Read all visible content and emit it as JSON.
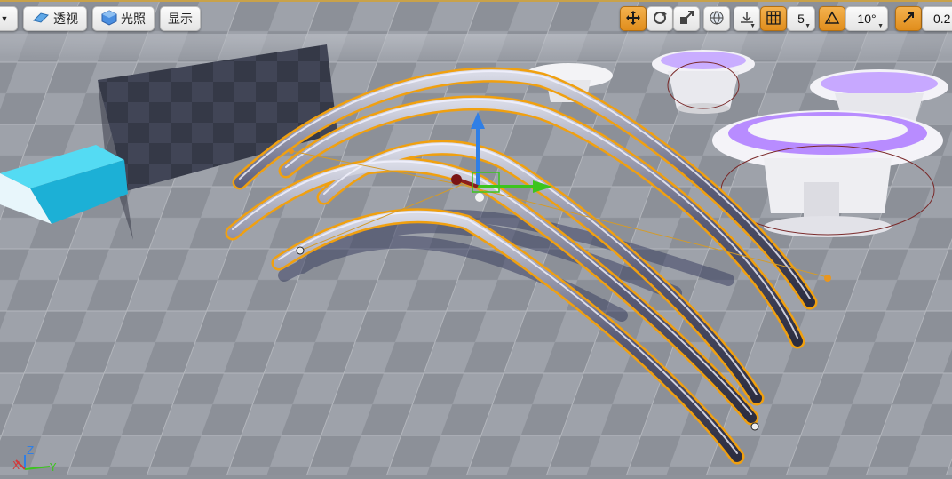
{
  "toolbar_left": {
    "perspective_label": "透视",
    "lighting_label": "光照",
    "show_label": "显示"
  },
  "toolbar_right": {
    "grid_snap_value": "5",
    "rotation_snap_value": "10°",
    "scale_snap_value": "0.2"
  },
  "axis_indicator": {
    "x": "X",
    "y": "Y",
    "z": "Z"
  },
  "colors": {
    "accent_orange": "#e8961f",
    "selection_outline": "#f0a010",
    "gizmo_x": "#c81e1e",
    "gizmo_y": "#3cc51e",
    "gizmo_z": "#2f7fe6",
    "floor": "#9a9ea6",
    "wall": "#3d4152",
    "cube": "#30c4e6",
    "fan_accent": "#b48cff"
  },
  "icons": [
    "perspective-icon",
    "lighting-icon",
    "move-icon",
    "rotate-icon",
    "scale-icon",
    "world-icon",
    "surface-snap-icon",
    "grid-icon",
    "angle-icon",
    "scale-snap-icon"
  ]
}
